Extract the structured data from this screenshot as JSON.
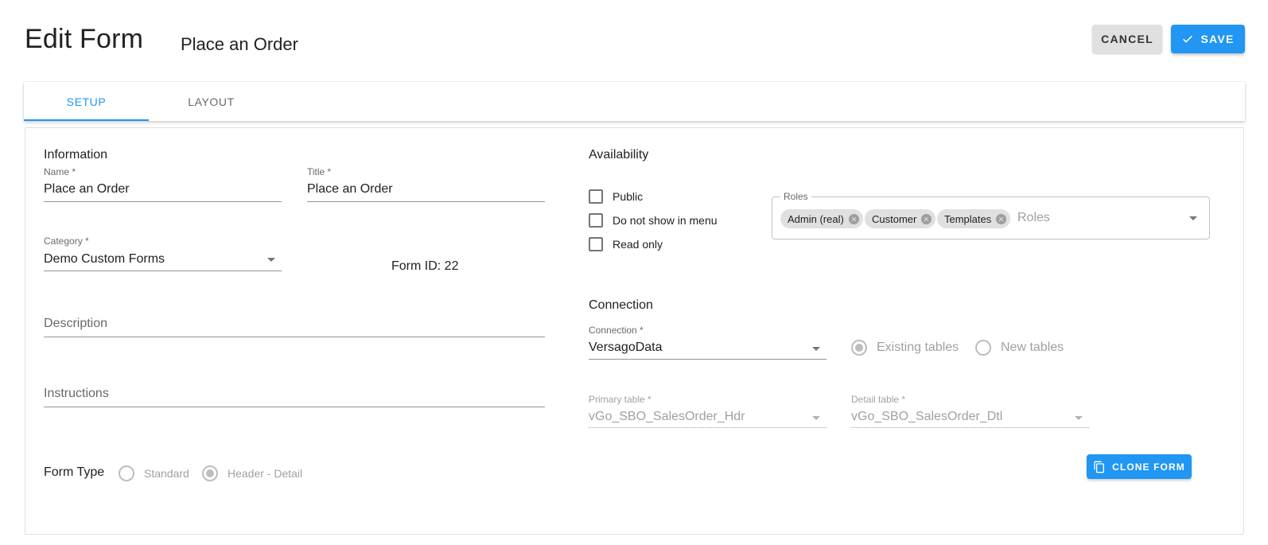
{
  "header": {
    "title": "Edit Form",
    "subtitle": "Place an Order",
    "cancel_label": "CANCEL",
    "save_label": "SAVE"
  },
  "tabs": [
    {
      "label": "SETUP",
      "active": true
    },
    {
      "label": "LAYOUT",
      "active": false
    }
  ],
  "information": {
    "section_title": "Information",
    "name": {
      "label": "Name *",
      "value": "Place an Order"
    },
    "title": {
      "label": "Title *",
      "value": "Place an Order"
    },
    "category": {
      "label": "Category *",
      "value": "Demo Custom Forms"
    },
    "form_id": "Form ID: 22",
    "description": {
      "placeholder": "Description"
    },
    "instructions": {
      "placeholder": "Instructions"
    },
    "form_type": {
      "label": "Form Type",
      "options": [
        "Standard",
        "Header - Detail"
      ],
      "selected": "Header - Detail"
    }
  },
  "availability": {
    "section_title": "Availability",
    "checkboxes": [
      {
        "label": "Public",
        "checked": false
      },
      {
        "label": "Do not show in menu",
        "checked": false
      },
      {
        "label": "Read only",
        "checked": false
      }
    ],
    "roles": {
      "label": "Roles",
      "chips": [
        "Admin (real)",
        "Customer",
        "Templates"
      ],
      "placeholder": "Roles"
    }
  },
  "connection": {
    "section_title": "Connection",
    "connection": {
      "label": "Connection *",
      "value": "VersagoData"
    },
    "table_mode": {
      "options": [
        "Existing tables",
        "New tables"
      ],
      "selected": "Existing tables"
    },
    "primary_table": {
      "label": "Primary table *",
      "value": "vGo_SBO_SalesOrder_Hdr"
    },
    "detail_table": {
      "label": "Detail table *",
      "value": "vGo_SBO_SalesOrder_Dtl"
    },
    "clone_label": "CLONE FORM"
  },
  "colors": {
    "primary": "#2196f3",
    "cancel_bg": "#e0e0e0",
    "chip_bg": "#e0e0e0"
  }
}
